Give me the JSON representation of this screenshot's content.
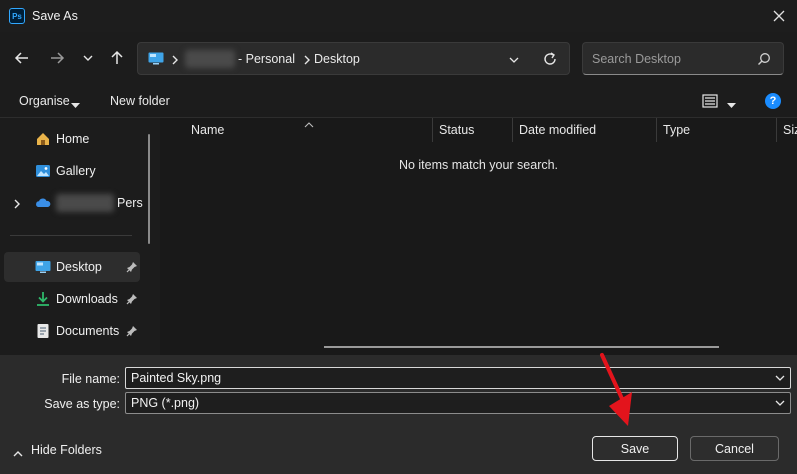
{
  "window": {
    "title": "Save As",
    "app_icon_text": "Ps"
  },
  "address_bar": {
    "crumbs": [
      "- Personal",
      "Desktop"
    ],
    "search_placeholder": "Search Desktop"
  },
  "toolbar": {
    "organise_label": "Organise",
    "new_folder_label": "New folder"
  },
  "sidebar": {
    "items": [
      {
        "label": "Home",
        "icon": "home-icon"
      },
      {
        "label": "Gallery",
        "icon": "gallery-icon"
      },
      {
        "label": "Pers",
        "icon": "onedrive-cloud-icon"
      },
      {
        "label": "Desktop",
        "icon": "desktop-icon",
        "pinned": true,
        "selected": true
      },
      {
        "label": "Downloads",
        "icon": "download-icon",
        "pinned": true
      },
      {
        "label": "Documents",
        "icon": "documents-icon",
        "pinned": true
      }
    ]
  },
  "file_list": {
    "columns": [
      "Name",
      "Status",
      "Date modified",
      "Type",
      "Siz"
    ],
    "empty_message": "No items match your search."
  },
  "form": {
    "file_name_label": "File name:",
    "file_name_value": "Painted Sky.png",
    "save_type_label": "Save as type:",
    "save_type_value": "PNG (*.png)"
  },
  "footer": {
    "hide_folders_label": "Hide Folders",
    "save_label": "Save",
    "cancel_label": "Cancel"
  },
  "colors": {
    "annotation_arrow": "#e3141c",
    "help_icon": "#1a8cff",
    "onedrive": "#3a8ee6",
    "download": "#2fb86a"
  }
}
